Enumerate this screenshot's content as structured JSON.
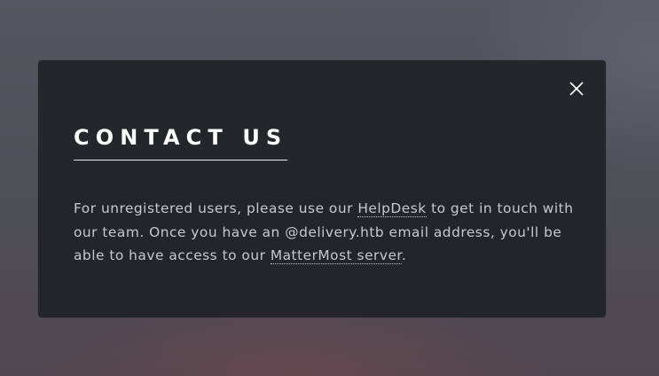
{
  "modal": {
    "close_icon": "close-icon",
    "title": "CONTACT US",
    "text": {
      "part1": "For unregistered users, please use our ",
      "helpdesk_link": "HelpDesk",
      "part2": " to get in touch with our team. Once you have an @delivery.htb email address, you'll be able to have access to our ",
      "mattermost_link": "MatterMost server",
      "part3": "."
    }
  },
  "colors": {
    "modal_bg": "#212328",
    "title": "#ffffff",
    "text": "#c8c9cd"
  }
}
